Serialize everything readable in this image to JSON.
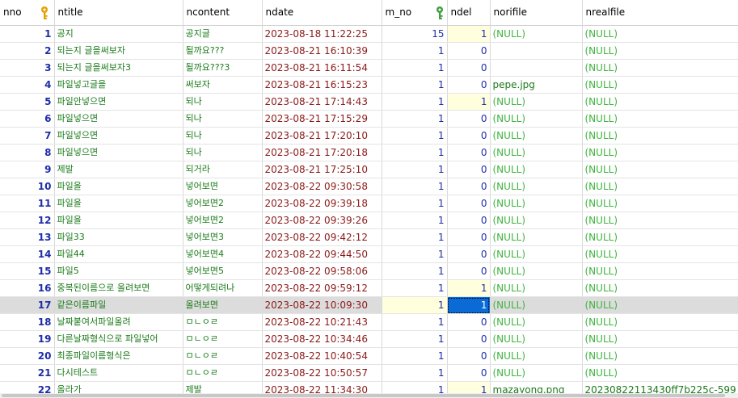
{
  "columns": [
    {
      "label": "nno",
      "key": true
    },
    {
      "label": "ntitle",
      "key": false
    },
    {
      "label": "ncontent",
      "key": false
    },
    {
      "label": "ndate",
      "key": false
    },
    {
      "label": "m_no",
      "key": true
    },
    {
      "label": "ndel",
      "key": false
    },
    {
      "label": "norifile",
      "key": false
    },
    {
      "label": "nrealfile",
      "key": false
    }
  ],
  "rows": [
    {
      "nno": "1",
      "ntitle": "공지",
      "ncontent": "공지글",
      "ndate": "2023-08-18 11:22:25",
      "m_no": "15",
      "ndel": "1",
      "norifile": "(NULL)",
      "nrealfile": "(NULL)"
    },
    {
      "nno": "2",
      "ntitle": "되는지 글을써보자",
      "ncontent": "될까요???",
      "ndate": "2023-08-21 16:10:39",
      "m_no": "1",
      "ndel": "0",
      "norifile": "",
      "nrealfile": "(NULL)"
    },
    {
      "nno": "3",
      "ntitle": "되는지 글을써보자3",
      "ncontent": "될까요???3",
      "ndate": "2023-08-21 16:11:54",
      "m_no": "1",
      "ndel": "0",
      "norifile": "",
      "nrealfile": "(NULL)"
    },
    {
      "nno": "4",
      "ntitle": "파일넣고글을",
      "ncontent": "써보자",
      "ndate": "2023-08-21 16:15:23",
      "m_no": "1",
      "ndel": "0",
      "norifile": "pepe.jpg",
      "nrealfile": "(NULL)"
    },
    {
      "nno": "5",
      "ntitle": "파일안넣으면",
      "ncontent": "되나",
      "ndate": "2023-08-21 17:14:43",
      "m_no": "1",
      "ndel": "1",
      "norifile": "(NULL)",
      "nrealfile": "(NULL)"
    },
    {
      "nno": "6",
      "ntitle": "파일넣으면",
      "ncontent": "되나",
      "ndate": "2023-08-21 17:15:29",
      "m_no": "1",
      "ndel": "0",
      "norifile": "(NULL)",
      "nrealfile": "(NULL)"
    },
    {
      "nno": "7",
      "ntitle": "파일넣으면",
      "ncontent": "되나",
      "ndate": "2023-08-21 17:20:10",
      "m_no": "1",
      "ndel": "0",
      "norifile": "(NULL)",
      "nrealfile": "(NULL)"
    },
    {
      "nno": "8",
      "ntitle": "파일넣으면",
      "ncontent": "되나",
      "ndate": "2023-08-21 17:20:18",
      "m_no": "1",
      "ndel": "0",
      "norifile": "(NULL)",
      "nrealfile": "(NULL)"
    },
    {
      "nno": "9",
      "ntitle": "제발",
      "ncontent": "되거라",
      "ndate": "2023-08-21 17:25:10",
      "m_no": "1",
      "ndel": "0",
      "norifile": "(NULL)",
      "nrealfile": "(NULL)"
    },
    {
      "nno": "10",
      "ntitle": "파일을",
      "ncontent": "넣어보면",
      "ndate": "2023-08-22 09:30:58",
      "m_no": "1",
      "ndel": "0",
      "norifile": "(NULL)",
      "nrealfile": "(NULL)"
    },
    {
      "nno": "11",
      "ntitle": "파일을",
      "ncontent": "넣어보면2",
      "ndate": "2023-08-22 09:39:18",
      "m_no": "1",
      "ndel": "0",
      "norifile": "(NULL)",
      "nrealfile": "(NULL)"
    },
    {
      "nno": "12",
      "ntitle": "파일을",
      "ncontent": "넣어보면2",
      "ndate": "2023-08-22 09:39:26",
      "m_no": "1",
      "ndel": "0",
      "norifile": "(NULL)",
      "nrealfile": "(NULL)"
    },
    {
      "nno": "13",
      "ntitle": "파일33",
      "ncontent": "넣어보면3",
      "ndate": "2023-08-22 09:42:12",
      "m_no": "1",
      "ndel": "0",
      "norifile": "(NULL)",
      "nrealfile": "(NULL)"
    },
    {
      "nno": "14",
      "ntitle": "파일44",
      "ncontent": "넣어보면4",
      "ndate": "2023-08-22 09:44:50",
      "m_no": "1",
      "ndel": "0",
      "norifile": "(NULL)",
      "nrealfile": "(NULL)"
    },
    {
      "nno": "15",
      "ntitle": "파일5",
      "ncontent": "넣어보면5",
      "ndate": "2023-08-22 09:58:06",
      "m_no": "1",
      "ndel": "0",
      "norifile": "(NULL)",
      "nrealfile": "(NULL)"
    },
    {
      "nno": "16",
      "ntitle": "중복된이름으로 올려보면",
      "ncontent": "어떻게되려나",
      "ndate": "2023-08-22 09:59:12",
      "m_no": "1",
      "ndel": "1",
      "norifile": "(NULL)",
      "nrealfile": "(NULL)"
    },
    {
      "nno": "17",
      "ntitle": "같은이름파일",
      "ncontent": "올려보면",
      "ndate": "2023-08-22 10:09:30",
      "m_no": "1",
      "ndel": "1",
      "norifile": "(NULL)",
      "nrealfile": "(NULL)"
    },
    {
      "nno": "18",
      "ntitle": "날짜붙여서파일올려",
      "ncontent": "ㅁㄴㅇㄹ",
      "ndate": "2023-08-22 10:21:43",
      "m_no": "1",
      "ndel": "0",
      "norifile": "(NULL)",
      "nrealfile": "(NULL)"
    },
    {
      "nno": "19",
      "ntitle": "다른날짜형식으로 파일넣어",
      "ncontent": "ㅁㄴㅇㄹ",
      "ndate": "2023-08-22 10:34:46",
      "m_no": "1",
      "ndel": "0",
      "norifile": "(NULL)",
      "nrealfile": "(NULL)"
    },
    {
      "nno": "20",
      "ntitle": "최종파일이름형식은",
      "ncontent": "ㅁㄴㅇㄹ",
      "ndate": "2023-08-22 10:40:54",
      "m_no": "1",
      "ndel": "0",
      "norifile": "(NULL)",
      "nrealfile": "(NULL)"
    },
    {
      "nno": "21",
      "ntitle": "다시테스트",
      "ncontent": "ㅁㄴㅇㄹ",
      "ndate": "2023-08-22 10:50:57",
      "m_no": "1",
      "ndel": "0",
      "norifile": "(NULL)",
      "nrealfile": "(NULL)"
    },
    {
      "nno": "22",
      "ntitle": "올라가",
      "ncontent": "제발",
      "ndate": "2023-08-22 11:34:30",
      "m_no": "1",
      "ndel": "1",
      "norifile": "mazayong.png",
      "nrealfile": "20230822113430ff7b225c-599"
    }
  ],
  "selected_row": 16,
  "highlighted_ndel_rows": [
    0,
    4,
    15,
    16,
    21
  ],
  "colors": {
    "key_icon": "#e8a000",
    "key_icon_green": "#3fa03f",
    "selection": "#0a6bd6",
    "selected_row": "#dcdcdc",
    "null_text": "#3fb43f"
  }
}
